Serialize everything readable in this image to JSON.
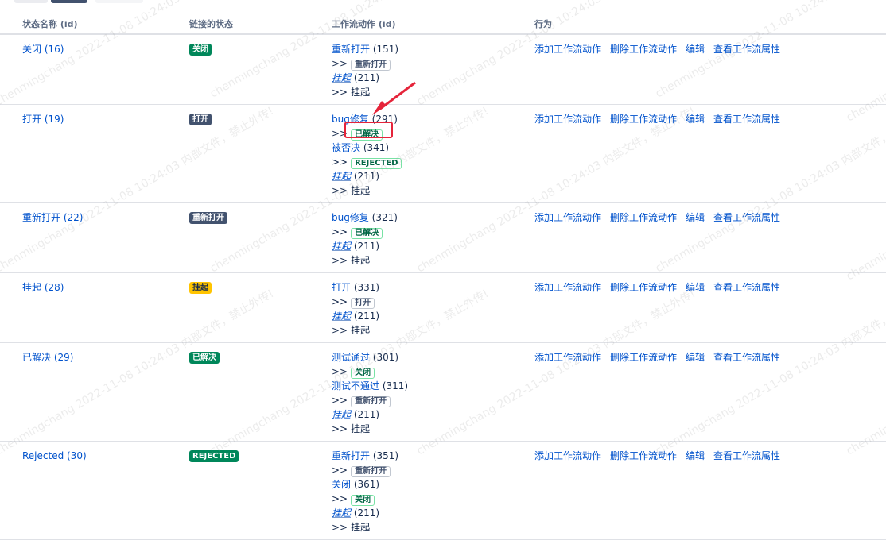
{
  "headers": {
    "status_name": "状态名称 (id)",
    "linked_status": "链接的状态",
    "transitions": "工作流动作 (id)",
    "actions": "行为"
  },
  "colors": {
    "link": "#0052cc",
    "green_lozenge": "#00875a",
    "dark_lozenge": "#42526e",
    "yellow_lozenge": "#ffc400",
    "highlight": "#e5243a"
  },
  "actions": {
    "add": "添加工作流动作",
    "delete": "删除工作流动作",
    "edit": "编辑",
    "props": "查看工作流属性"
  },
  "rows": [
    {
      "name": "关闭 (16)",
      "lozenge": "关闭",
      "t": [
        {
          "name": "重新打开",
          "id": "(151)",
          "target": "重新打开",
          "boxed": true
        },
        {
          "name": "挂起",
          "id": "(211)",
          "target": "挂起",
          "boxed": false
        }
      ]
    },
    {
      "name": "打开 (19)",
      "lozenge": "打开",
      "t": [
        {
          "name": "bug修复",
          "id": "(291)",
          "target": "已解决",
          "boxed": true
        },
        {
          "name": "被否决",
          "id": "(341)",
          "target": "REJECTED",
          "boxed": true
        },
        {
          "name": "挂起",
          "id": "(211)",
          "target": "挂起",
          "boxed": false
        }
      ]
    },
    {
      "name": "重新打开 (22)",
      "lozenge": "重新打开",
      "t": [
        {
          "name": "bug修复",
          "id": "(321)",
          "target": "已解决",
          "boxed": true
        },
        {
          "name": "挂起",
          "id": "(211)",
          "target": "挂起",
          "boxed": false
        }
      ]
    },
    {
      "name": "挂起 (28)",
      "lozenge": "挂起",
      "t": [
        {
          "name": "打开",
          "id": "(331)",
          "target": "打开",
          "boxed": true
        },
        {
          "name": "挂起",
          "id": "(211)",
          "target": "挂起",
          "boxed": false
        }
      ]
    },
    {
      "name": "已解决 (29)",
      "lozenge": "已解决",
      "t": [
        {
          "name": "测试通过",
          "id": "(301)",
          "target": "关闭",
          "boxed": true
        },
        {
          "name": "测试不通过",
          "id": "(311)",
          "target": "重新打开",
          "boxed": true
        },
        {
          "name": "挂起",
          "id": "(211)",
          "target": "挂起",
          "boxed": false
        }
      ]
    },
    {
      "name": "Rejected (30)",
      "lozenge": "REJECTED",
      "t": [
        {
          "name": "重新打开",
          "id": "(351)",
          "target": "重新打开",
          "boxed": true
        },
        {
          "name": "关闭",
          "id": "(361)",
          "target": "关闭",
          "boxed": true
        },
        {
          "name": "挂起",
          "id": "(211)",
          "target": "挂起",
          "boxed": false
        }
      ]
    }
  ],
  "arrow_symbol": ">>",
  "watermark_text": "chenmingchang 2022-11-08 10:24:03 内部文件，禁止外传!"
}
